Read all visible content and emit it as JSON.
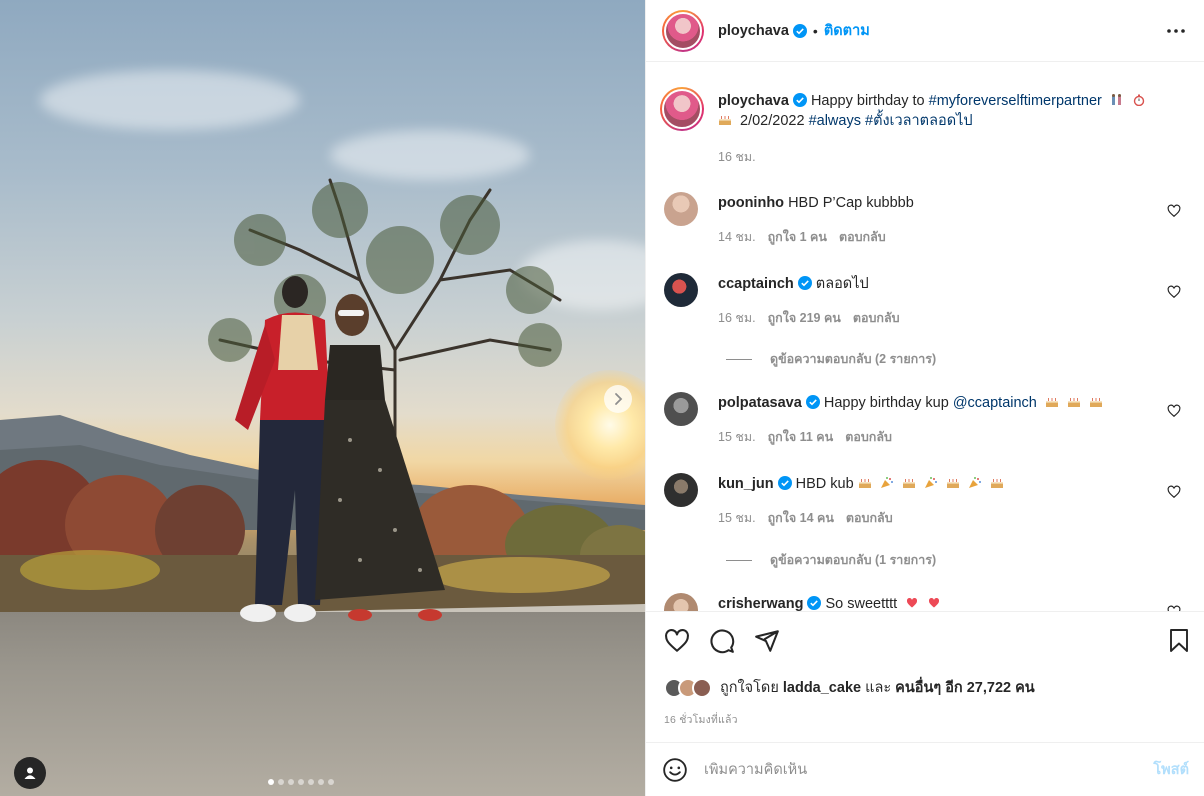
{
  "post": {
    "author": "ploychava",
    "follow_label": "ติดตาม",
    "separator": "•",
    "caption": {
      "username": "ploychava",
      "text_1": "Happy birthday to ",
      "hashtag_1": "#myforeverselftimerpartner",
      "text_2": " 2/02/2022 ",
      "hashtag_2": "#always",
      "hashtag_3": "#ตั้งเวลาตลอดไป",
      "time": "16 ชม."
    },
    "carousel": {
      "count": 7,
      "active": 0
    }
  },
  "comments": [
    {
      "username": "pooninho",
      "verified": false,
      "text": "HBD P’Cap kubbbb",
      "time": "14 ชม.",
      "likes": "ถูกใจ 1 คน",
      "reply": "ตอบกลับ",
      "avatar_color": "#c9a38f"
    },
    {
      "username": "ccaptainch",
      "verified": true,
      "text": "ตลอดไป",
      "time": "16 ชม.",
      "likes": "ถูกใจ 219 คน",
      "reply": "ตอบกลับ",
      "view_replies": "ดูข้อความตอบกลับ (2 รายการ)",
      "avatar_color": "#1f2a38"
    },
    {
      "username": "polpatasava",
      "verified": true,
      "text": "Happy birthday kup ",
      "mention": "@ccaptainch",
      "time": "15 ชม.",
      "likes": "ถูกใจ 11 คน",
      "reply": "ตอบกลับ",
      "avatar_color": "#6f6f6f"
    },
    {
      "username": "kun_jun",
      "verified": true,
      "text": "HBD kub",
      "time": "15 ชม.",
      "likes": "ถูกใจ 14 คน",
      "reply": "ตอบกลับ",
      "view_replies": "ดูข้อความตอบกลับ (1 รายการ)",
      "avatar_color": "#3a3a3a"
    },
    {
      "username": "crisherwang",
      "verified": true,
      "text": "So sweetttt",
      "avatar_color": "#b08a70"
    }
  ],
  "likes": {
    "prefix": "ถูกใจโดย ",
    "user": "ladda_cake",
    "middle": " และ ",
    "others": "คนอื่นๆ อีก 27,722 คน",
    "avatars": [
      "#5a5a5a",
      "#c99a7a",
      "#8a5e52"
    ]
  },
  "time_ago": "16 ชั่วโมงที่แล้ว",
  "add_comment": {
    "placeholder": "เพิ่มความคิดเห็น",
    "post_label": "โพสต์"
  },
  "icons": [
    "heart-icon",
    "comment-icon",
    "share-icon",
    "bookmark-icon",
    "emoji-icon",
    "more-icon",
    "verified-icon",
    "chevron-right-icon",
    "user-tag-icon"
  ],
  "colors": {
    "accent": "#0095f6",
    "hashtag": "#00376b",
    "muted": "#8e8e8e",
    "post_disabled": "#b2dffc",
    "heart_red": "#ed4956"
  }
}
